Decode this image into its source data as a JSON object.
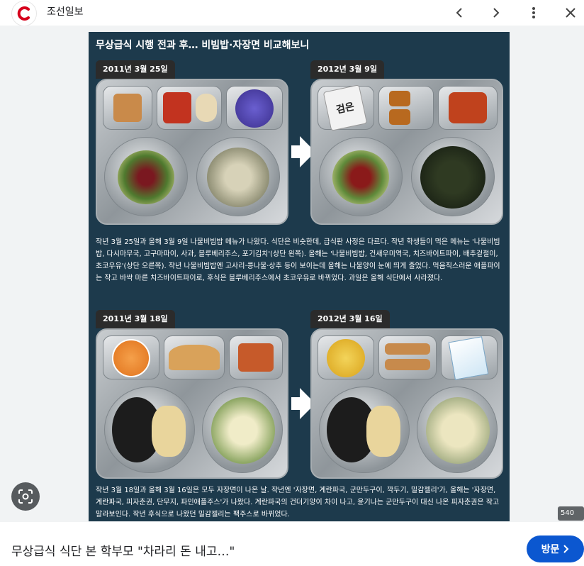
{
  "topbar": {
    "site_name": "조선일보",
    "icons": [
      "chosun-logo-icon",
      "chevron-left-icon",
      "chevron-right-icon",
      "more-vert-icon",
      "close-icon"
    ]
  },
  "figure": {
    "title": "무상급식 시행 전과 후… 비빔밥·자장면 비교해보니",
    "top_left_date": "2011년 3월 25일",
    "top_right_date": "2012년 3월 9일",
    "milk_label": "검은",
    "caption_top": "작년 3월 25일과 올해 3월 9일 나물비빔밥 메뉴가 나왔다. 식단은 비슷한데, 급식판 사정은 다르다. 작년 학생들이 먹은 메뉴는 '나물비빔밥, 다시마무국, 고구마파이, 사과, 블루베리주스, 포기김치'(상단 왼쪽). 올해는 '나물비빔밥, 건새우미역국, 치즈바이트파이, 배추겉절이, 초코우유'(상단 오른쪽). 작년 나물비빔밥엔 고사리·콩나물·상추 등이 보이는데 올해는 나물양이 눈에 띄게 줄었다. 먹음직스러운 애플파이는 작고 바싹 마른 치즈바이트파이로, 후식은 블루베리주스에서 초코우유로 바뀌었다. 과일은 올해 식단에서 사라졌다.",
    "bottom_left_date": "2011년 3월 18일",
    "bottom_right_date": "2012년 3월 16일",
    "caption_bottom": "작년 3월 18일과 올해 3월 16일은 모두 자장면이 나온 날. 작년엔 '자장면, 계란파국, 군만두구이, 깍두기, 밀감젤리'가, 올해는 '자장면, 계란파국, 피자춘권, 단무지, 파인애플주스'가 나왔다. 계란파국의 건더기양이 차이 나고, 윤기나는 군만두구이 대신 나온 피자춘권은 작고 말라보인다. 작년 후식으로 나왔던 밀감젤리는 팩주스로 바뀌었다."
  },
  "viewer": {
    "size_badge": "540 ×",
    "zoom_icon": "lens-search-icon"
  },
  "bottom": {
    "headline": "무상급식 식단 본 학부모 \"차라리 돈 내고…\"",
    "visit_label": "방문"
  },
  "colors": {
    "figure_bg": "#1d3a4c",
    "visit_button": "#0b57d0",
    "logo_red": "#d6001c"
  }
}
